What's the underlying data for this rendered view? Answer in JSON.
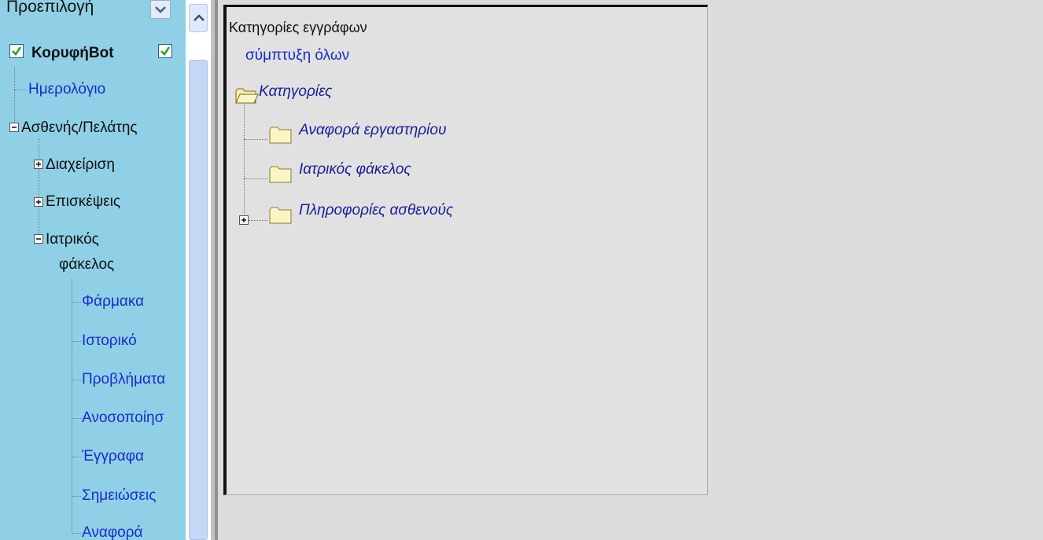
{
  "nav": {
    "dropdown_value": "Προεπιλογή",
    "root_label": "ΚορυφήBot",
    "items": [
      {
        "label": "Ημερολόγιο"
      },
      {
        "label": "Ασθενής/Πελάτης"
      },
      {
        "label": "Διαχείριση"
      },
      {
        "label": "Επισκέψεις"
      },
      {
        "label_line1": "Ιατρικός",
        "label_line2": "φάκελος"
      },
      {
        "label": "Φάρμακα"
      },
      {
        "label": "Ιστορικό"
      },
      {
        "label": "Προβλήματα"
      },
      {
        "label": "Ανοσοποίησ"
      },
      {
        "label": "Έγγραφα"
      },
      {
        "label": "Σημειώσεις"
      },
      {
        "label": "Αναφορά"
      }
    ]
  },
  "panel": {
    "title": "Κατηγορίες εγγράφων",
    "collapse_all": "σύμπτυξη όλων",
    "root": "Κατηγορίες",
    "children": [
      {
        "label": "Αναφορά εργαστηρίου"
      },
      {
        "label": "Ιατρικός φάκελος"
      },
      {
        "label": "Πληροφορίες ασθενούς"
      }
    ]
  },
  "icons": [
    "checkbox-checked-icon",
    "chevron-down-icon",
    "chevron-up-icon",
    "plus-box-icon",
    "minus-box-icon",
    "folder-icon",
    "folder-open-icon"
  ]
}
